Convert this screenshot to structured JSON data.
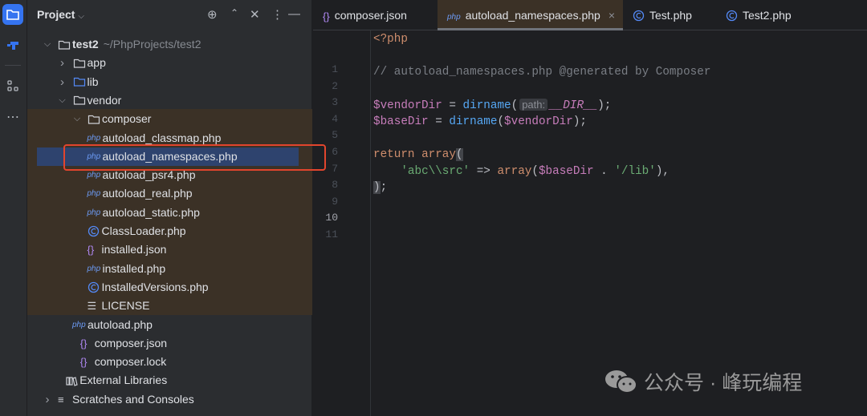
{
  "stripe": {
    "icons": [
      "project-icon",
      "structure-icon",
      "plugins-icon",
      "more-icon"
    ]
  },
  "panel": {
    "title": "Project",
    "tools": [
      "locate-icon",
      "expand-all-icon",
      "collapse-all-icon",
      "options-icon",
      "hide-icon"
    ]
  },
  "tree": [
    {
      "depth": 0,
      "chev": "down",
      "icon": "folder",
      "label": "test2",
      "path": "~/PhpProjects/test2",
      "bold": true
    },
    {
      "depth": 1,
      "chev": "right",
      "icon": "folder",
      "label": "app"
    },
    {
      "depth": 1,
      "chev": "right",
      "icon": "folder-blue",
      "label": "lib"
    },
    {
      "depth": 1,
      "chev": "down",
      "icon": "folder",
      "label": "vendor"
    },
    {
      "depth": 2,
      "chev": "down",
      "icon": "folder",
      "label": "composer"
    },
    {
      "depth": 3,
      "icon": "php",
      "label": "autoload_classmap.php"
    },
    {
      "depth": 3,
      "icon": "php",
      "label": "autoload_namespaces.php",
      "selected": true
    },
    {
      "depth": 3,
      "icon": "php",
      "label": "autoload_psr4.php"
    },
    {
      "depth": 3,
      "icon": "php",
      "label": "autoload_real.php"
    },
    {
      "depth": 3,
      "icon": "php",
      "label": "autoload_static.php"
    },
    {
      "depth": 3,
      "icon": "class",
      "label": "ClassLoader.php"
    },
    {
      "depth": 3,
      "icon": "json",
      "label": "installed.json"
    },
    {
      "depth": 3,
      "icon": "php",
      "label": "installed.php"
    },
    {
      "depth": 3,
      "icon": "class",
      "label": "InstalledVersions.php"
    },
    {
      "depth": 3,
      "icon": "text",
      "label": "LICENSE"
    },
    {
      "depth": 2,
      "icon": "php",
      "label": "autoload.php"
    },
    {
      "depth": 1.5,
      "icon": "json",
      "label": "composer.json"
    },
    {
      "depth": 1.5,
      "icon": "json",
      "label": "composer.lock"
    },
    {
      "depth": 0.5,
      "icon": "library",
      "label": "External Libraries"
    },
    {
      "depth": 0,
      "chev": "right",
      "icon": "scratches",
      "label": "Scratches and Consoles"
    }
  ],
  "tabs": [
    {
      "icon": "json",
      "label": "composer.json"
    },
    {
      "icon": "php",
      "label": "autoload_namespaces.php",
      "active": true,
      "closable": true
    },
    {
      "icon": "class",
      "label": "Test.php"
    },
    {
      "icon": "class",
      "label": "Test2.php"
    }
  ],
  "editor": {
    "current_line": 10,
    "lines": [
      [
        [
          "<?php",
          "kw"
        ]
      ],
      [],
      [
        [
          "// autoload_namespaces.php @generated by Composer",
          "cmt"
        ]
      ],
      [],
      [
        [
          "$vendorDir",
          "var"
        ],
        [
          " = ",
          ""
        ],
        [
          "dirname",
          "fn"
        ],
        [
          "(",
          ""
        ],
        [
          "path:",
          "hint"
        ],
        [
          "__DIR__",
          "ital"
        ],
        [
          ");",
          ""
        ]
      ],
      [
        [
          "$baseDir",
          "var"
        ],
        [
          " = ",
          ""
        ],
        [
          "dirname",
          "fn"
        ],
        [
          "(",
          ""
        ],
        [
          "$vendorDir",
          "var"
        ],
        [
          ");",
          ""
        ]
      ],
      [],
      [
        [
          "return ",
          "kw"
        ],
        [
          "array",
          "kw"
        ],
        [
          "(",
          "brace"
        ]
      ],
      [
        [
          "    ",
          ""
        ],
        [
          "'abc\\\\src'",
          "str"
        ],
        [
          " => ",
          ""
        ],
        [
          "array",
          "kw"
        ],
        [
          "(",
          ""
        ],
        [
          "$baseDir",
          "var"
        ],
        [
          " . ",
          ""
        ],
        [
          "'/lib'",
          "str"
        ],
        [
          "),",
          ""
        ]
      ],
      [
        [
          ")",
          "brace"
        ],
        [
          ";",
          ""
        ]
      ],
      []
    ]
  },
  "watermark": {
    "text": "公众号 · 峰玩编程"
  },
  "colors": {
    "accent": "#3574f0",
    "selection": "#2e436e",
    "highlight_box": "#e2452d",
    "vendor_bg": "#3b3126"
  }
}
